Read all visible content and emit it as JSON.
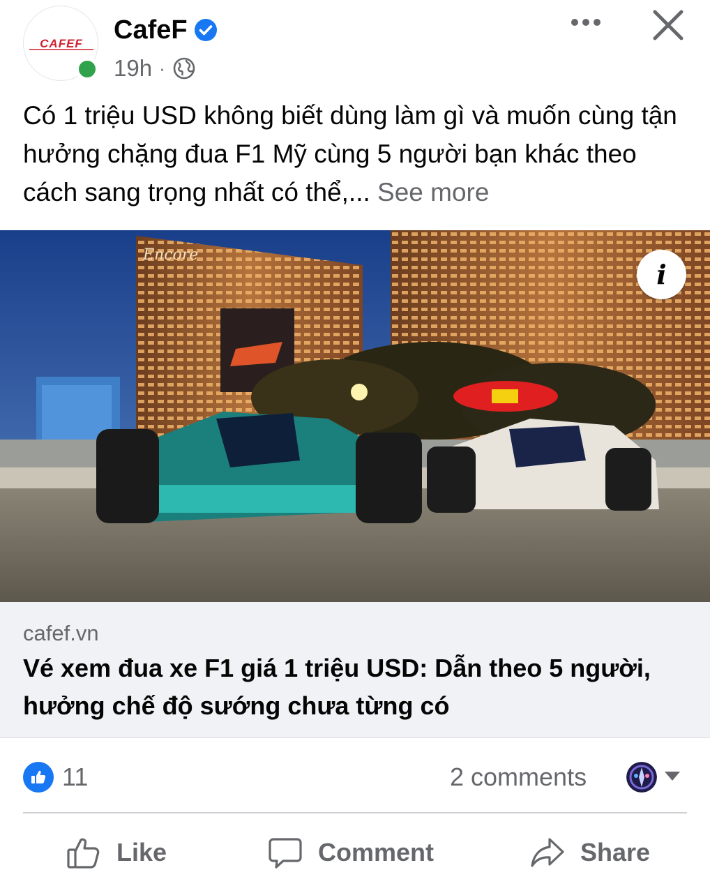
{
  "post": {
    "page_name": "CafeF",
    "time": "19h",
    "separator": "·",
    "logo_text": "CAFEF",
    "caption": "Có 1 triệu USD không biết dùng làm gì và muốn cùng tận hưởng chặng đua F1 Mỹ cùng 5 người bạn khác theo cách sang trọng nhất có thể,...",
    "see_more": "See more"
  },
  "image": {
    "sign_text": "Encore",
    "info_icon": "i"
  },
  "link_preview": {
    "domain": "cafef.vn",
    "title": "Vé xem đua xe F1 giá 1 triệu USD: Dẫn theo 5 người, hưởng chế độ sướng chưa từng có"
  },
  "stats": {
    "reactions_count": "11",
    "comments": "2 comments"
  },
  "actions": {
    "like": "Like",
    "comment": "Comment",
    "share": "Share"
  },
  "icons": [
    "verified-icon",
    "globe-icon",
    "more-icon",
    "close-icon",
    "info-icon",
    "like-reaction-icon",
    "thumbs-up-icon",
    "comment-icon",
    "share-icon",
    "chevron-down-icon"
  ],
  "colors": {
    "accent": "#1877f2",
    "online": "#31a24c",
    "secondary_text": "#65676b",
    "link_bg": "#f0f2f5"
  }
}
